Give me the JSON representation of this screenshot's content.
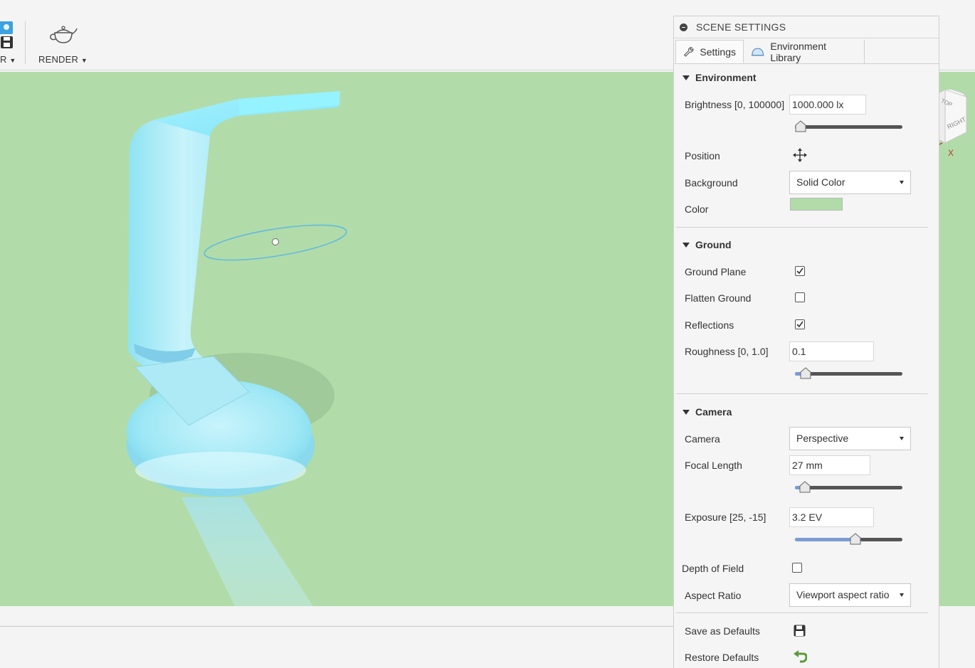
{
  "toolbar": {
    "prev_label": "R",
    "render_label": "RENDER"
  },
  "panel": {
    "title": "SCENE SETTINGS",
    "tabs": [
      {
        "label": "Settings",
        "icon": "wrench-icon"
      },
      {
        "label": "Environment Library",
        "icon": "dome-icon"
      }
    ],
    "environment": {
      "header": "Environment",
      "brightness_label": "Brightness [0, 100000]",
      "brightness_value": "1000.000 lx",
      "position_label": "Position",
      "background_label": "Background",
      "background_value": "Solid Color",
      "color_label": "Color",
      "color_value": "#b1dca9"
    },
    "ground": {
      "header": "Ground",
      "ground_plane_label": "Ground Plane",
      "ground_plane_checked": true,
      "flatten_label": "Flatten Ground",
      "flatten_checked": false,
      "reflections_label": "Reflections",
      "reflections_checked": true,
      "roughness_label": "Roughness [0, 1.0]",
      "roughness_value": "0.1"
    },
    "camera": {
      "header": "Camera",
      "camera_label": "Camera",
      "camera_value": "Perspective",
      "focal_label": "Focal Length",
      "focal_value": "27 mm",
      "exposure_label": "Exposure [25, -15]",
      "exposure_value": "3.2 EV",
      "dof_label": "Depth of Field",
      "dof_checked": false,
      "aspect_label": "Aspect Ratio",
      "aspect_value": "Viewport aspect ratio"
    },
    "save_label": "Save as Defaults",
    "restore_label": "Restore Defaults"
  },
  "viewcube": {
    "top": "TOP",
    "right": "RIGHT",
    "axis_x": "X"
  },
  "sliders": {
    "brightness": 0.01,
    "roughness": 0.1,
    "focal_length": 0.09,
    "exposure": 0.56
  },
  "colors": {
    "viewport_bg": "#b1dca9",
    "slider_fill": "#7c9bd6",
    "model_tint": "#8fe9f6"
  }
}
